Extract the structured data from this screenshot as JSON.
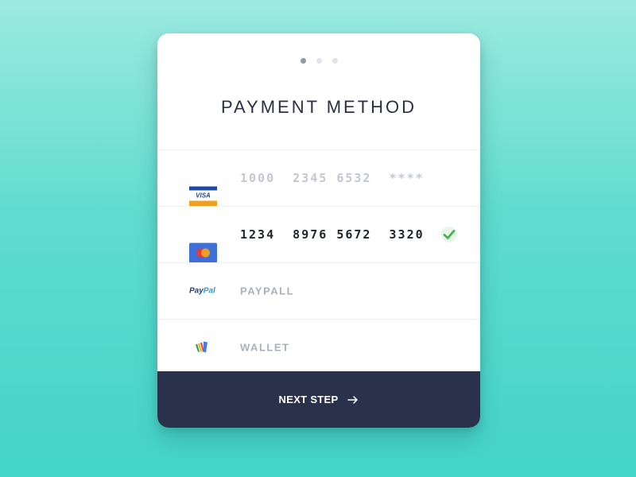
{
  "step_indicator": {
    "total": 3,
    "current": 1
  },
  "title": "PAYMENT METHOD",
  "methods": [
    {
      "type": "visa",
      "logo_text": "VISA",
      "text": "1000  2345 6532  ****",
      "selected": false
    },
    {
      "type": "mastercard",
      "text": "1234  8976 5672  3320",
      "selected": true
    },
    {
      "type": "paypal",
      "logo_text_a": "Pay",
      "logo_text_b": "Pal",
      "text": "PAYPALL",
      "selected": false
    },
    {
      "type": "wallet",
      "text": "WALLET",
      "selected": false
    }
  ],
  "footer": {
    "label": "NEXT STEP"
  },
  "colors": {
    "background_top": "#9ceadf",
    "background_bottom": "#44d4c8",
    "footer": "#2a314b",
    "check": "#4caf50",
    "inactive_text": "#c3c8d1",
    "active_text": "#1f2330"
  },
  "icons": {
    "selected": "check-icon",
    "next": "arrow-right-icon"
  }
}
